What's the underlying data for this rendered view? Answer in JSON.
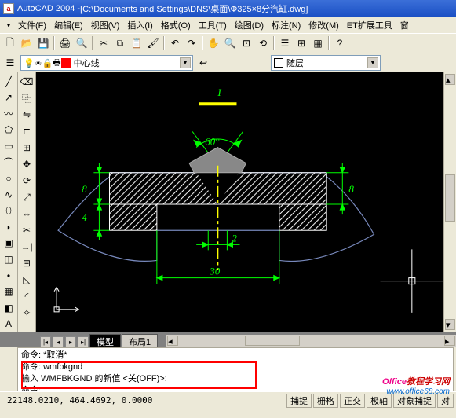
{
  "title": {
    "prefix": "AutoCAD 2004 - ",
    "path": "[C:\\Documents and Settings\\DNS\\桌面\\Φ325×8分汽缸.dwg]"
  },
  "menus": [
    "文件(F)",
    "编辑(E)",
    "视图(V)",
    "插入(I)",
    "格式(O)",
    "工具(T)",
    "绘图(D)",
    "标注(N)",
    "修改(M)",
    "ET扩展工具",
    "窗"
  ],
  "layer_combo": "中心线",
  "linetype_combo": "随层",
  "tabs": {
    "model": "模型",
    "layout": "布局1"
  },
  "cmd": {
    "l1": "命令:  *取消*",
    "l2": "命令:  wmfbkgnd",
    "l3": "输入 WMFBKGND 的新值 <关(OFF)>:",
    "l4": "命令:"
  },
  "status": {
    "coords": "22148.0210, 464.4692, 0.0000",
    "btns": [
      "捕捉",
      "栅格",
      "正交",
      "极轴",
      "对象捕捉",
      "对"
    ]
  },
  "drawing": {
    "angle": "60°",
    "dim_h1": "8",
    "dim_h2": "4",
    "dim_h3": "8",
    "dim_w1": "2",
    "dim_w2": "30",
    "cursor_label": "I"
  },
  "watermark": {
    "red": "Office",
    "blue": "教程学习网",
    "url": "www.office68.com"
  }
}
